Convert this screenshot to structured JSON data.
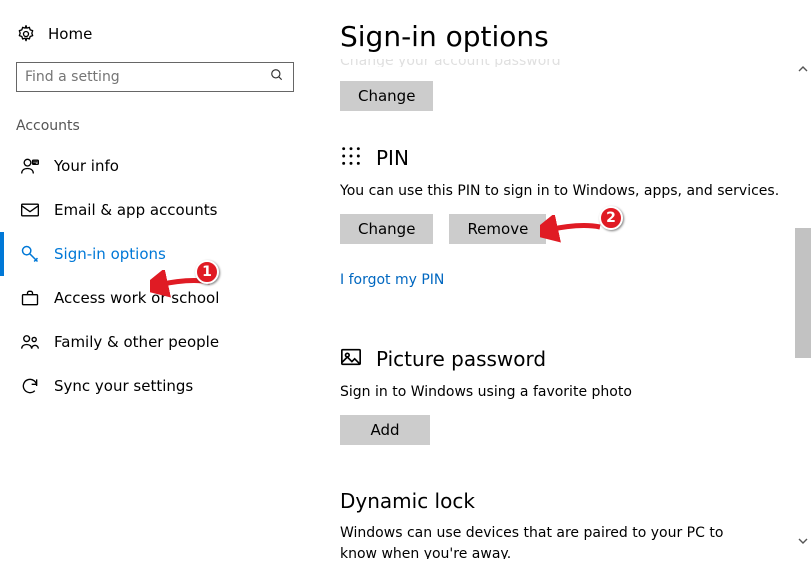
{
  "home_label": "Home",
  "search_placeholder": "Find a setting",
  "category": "Accounts",
  "nav": [
    {
      "id": "your-info",
      "label": "Your info"
    },
    {
      "id": "email-accounts",
      "label": "Email & app accounts"
    },
    {
      "id": "sign-in-options",
      "label": "Sign-in options"
    },
    {
      "id": "access-work-school",
      "label": "Access work or school"
    },
    {
      "id": "family-people",
      "label": "Family & other people"
    },
    {
      "id": "sync-settings",
      "label": "Sync your settings"
    }
  ],
  "page_title": "Sign-in options",
  "cut_line": "Change your account password",
  "cut_button": "Change",
  "pin": {
    "title": "PIN",
    "desc": "You can use this PIN to sign in to Windows, apps, and services.",
    "change": "Change",
    "remove": "Remove",
    "forgot": "I forgot my PIN"
  },
  "picpwd": {
    "title": "Picture password",
    "desc": "Sign in to Windows using a favorite photo",
    "add": "Add"
  },
  "dynlock": {
    "title": "Dynamic lock",
    "desc": "Windows can use devices that are paired to your PC to know when you're away."
  },
  "callouts": {
    "one": "1",
    "two": "2"
  }
}
